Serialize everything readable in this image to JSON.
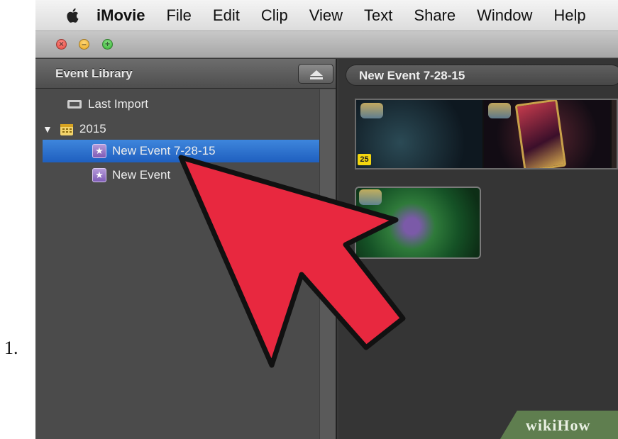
{
  "step": {
    "number": "1."
  },
  "menubar": {
    "items": [
      "iMovie",
      "File",
      "Edit",
      "Clip",
      "View",
      "Text",
      "Share",
      "Window",
      "Help"
    ]
  },
  "sidebar": {
    "title": "Event Library",
    "items": [
      {
        "label": "Last Import",
        "icon": "film-roll-icon"
      },
      {
        "label": "2015",
        "icon": "calendar-icon",
        "expanded": true
      },
      {
        "label": "New Event 7-28-15",
        "icon": "star-event-icon",
        "selected": true
      },
      {
        "label": "New Event",
        "icon": "star-event-icon"
      }
    ]
  },
  "content": {
    "title": "New Event 7-28-15",
    "clips": [
      {
        "badge": "25"
      },
      {}
    ]
  },
  "watermark": {
    "text": "wikiHow"
  },
  "colors": {
    "selection": "#2a6fd1",
    "arrow_fill": "#e8283f",
    "badge": "#f3d60f"
  }
}
